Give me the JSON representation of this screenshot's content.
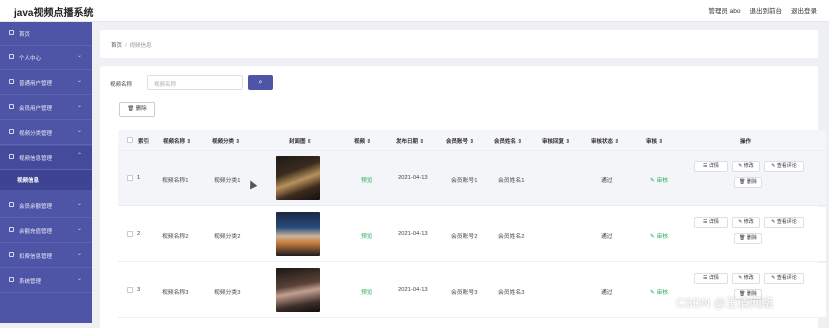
{
  "app": {
    "title": "java视频点播系统"
  },
  "header": {
    "admin": "管理员 abo",
    "links": [
      "退出到前台",
      "退出登录"
    ]
  },
  "sidebar": {
    "items": [
      {
        "label": "首页",
        "chevron": false
      },
      {
        "label": "个人中心",
        "chevron": true
      },
      {
        "label": "普通用户管理",
        "chevron": true
      },
      {
        "label": "会员用户管理",
        "chevron": true
      },
      {
        "label": "视频分类管理",
        "chevron": true
      },
      {
        "label": "视频信息管理",
        "chevron": true,
        "open": true
      },
      {
        "label": "会员余额管理",
        "chevron": true
      },
      {
        "label": "余额充值管理",
        "chevron": true
      },
      {
        "label": "扣费信息管理",
        "chevron": true
      },
      {
        "label": "系统管理",
        "chevron": true
      }
    ],
    "sub_item": "视频信息"
  },
  "breadcrumb": {
    "home": "首页",
    "separator": "/",
    "current": "视频信息"
  },
  "search": {
    "label": "视频名称",
    "placeholder": "视频名称",
    "button_icon": "search-icon"
  },
  "toolbar": {
    "delete_label": "删除",
    "delete_icon": "trash-icon"
  },
  "table": {
    "columns": [
      "索引",
      "视频名称 ⇕",
      "视频分类 ⇕",
      "封面图 ⇕",
      "视频 ⇕",
      "发布日期 ⇕",
      "会员账号 ⇕",
      "会员姓名 ⇕",
      "审核回复 ⇕",
      "审核状态 ⇕",
      "审核 ⇕",
      "操作"
    ],
    "rows": [
      {
        "index": "1",
        "name": "视频名称1",
        "category": "视频分类1",
        "video": "预览",
        "date": "2021-04-13",
        "account": "会员账号1",
        "member": "会员姓名1",
        "reply": "",
        "status": "通过",
        "audit": "审核"
      },
      {
        "index": "2",
        "name": "视频名称2",
        "category": "视频分类2",
        "video": "预览",
        "date": "2021-04-13",
        "account": "会员账号2",
        "member": "会员姓名2",
        "reply": "",
        "status": "通过",
        "audit": "审核"
      },
      {
        "index": "3",
        "name": "视频名称3",
        "category": "视频分类3",
        "video": "预览",
        "date": "2021-04-13",
        "account": "会员账号3",
        "member": "会员姓名3",
        "reply": "",
        "status": "通过",
        "audit": "审核"
      }
    ],
    "actions": {
      "detail": "详情",
      "edit": "修改",
      "comments": "查看评论",
      "delete": "删除"
    }
  },
  "watermark": "CSDN @王倩网络",
  "colors": {
    "sidebar": "#4f55a6",
    "accent": "#4f55a6",
    "success": "#27ae60"
  }
}
